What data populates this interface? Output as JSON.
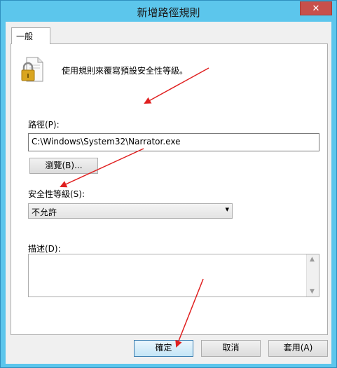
{
  "window": {
    "title": "新增路徑規則",
    "close_glyph": "✕"
  },
  "tabs": [
    {
      "label": "一般"
    }
  ],
  "general": {
    "description": "使用規則來覆寫預設安全性等級。",
    "path_label": "路徑(P):",
    "path_value": "C:\\Windows\\System32\\Narrator.exe",
    "browse_label": "瀏覽(B)...",
    "security_level_label": "安全性等級(S):",
    "security_level_value": "不允許",
    "description_label": "描述(D):",
    "description_value": ""
  },
  "buttons": {
    "ok": "確定",
    "cancel": "取消",
    "apply": "套用(A)"
  },
  "colors": {
    "titlebar": "#5cc6ec",
    "close": "#c7504b",
    "annotation_arrow": "#e02020"
  }
}
